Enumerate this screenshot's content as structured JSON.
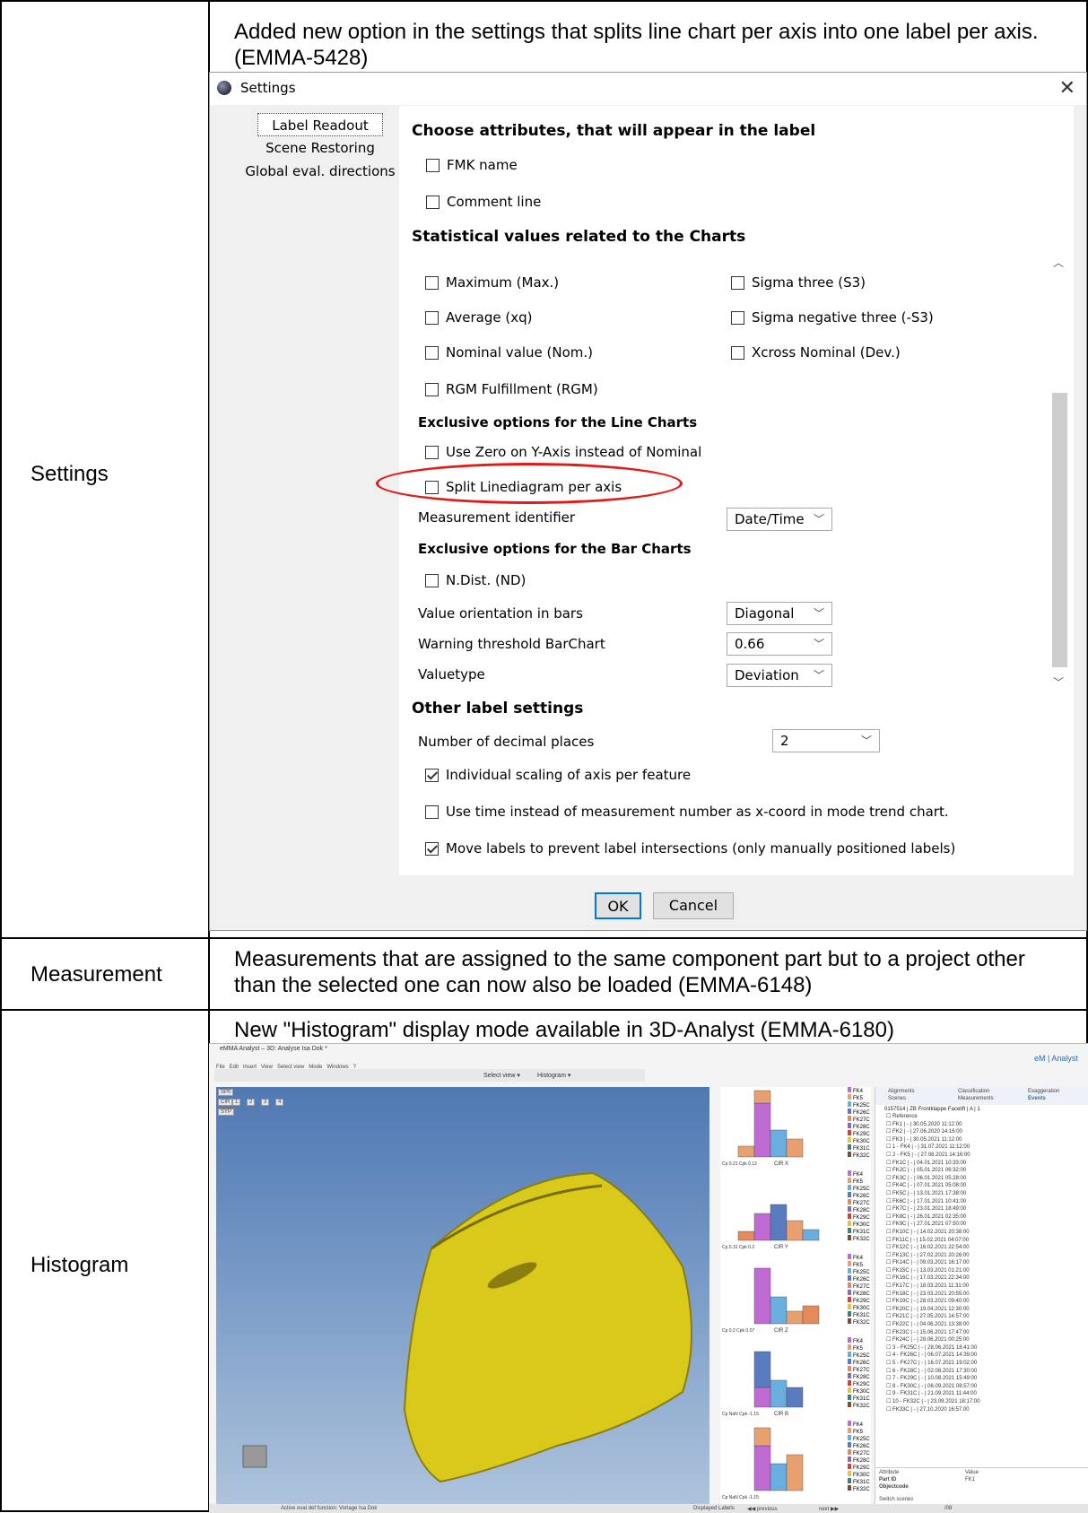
{
  "rows": [
    {
      "label": "Settings",
      "description": "Added new option in the settings that splits line chart per axis into one label per axis. (EMMA-5428)"
    },
    {
      "label": "Measurement",
      "description": "Measurements that are assigned to the same component part but to a project other than the selected one can now also be loaded (EMMA-6148)"
    },
    {
      "label": "Histogram",
      "description": "New \"Histogram\" display mode available in 3D-Analyst (EMMA-6180)"
    }
  ],
  "dialog": {
    "title": "Settings",
    "nav": [
      "Label Readout",
      "Scene Restoring",
      "Global eval. directions"
    ],
    "sections": {
      "attributes": "Choose attributes, that will appear in the label",
      "statistical": "Statistical values related to the Charts",
      "line": "Exclusive options for the Line Charts",
      "bar": "Exclusive options for the Bar Charts",
      "other": "Other label settings"
    },
    "attributes": [
      {
        "label": "FMK name",
        "checked": false
      },
      {
        "label": "Comment line",
        "checked": false
      }
    ],
    "statistical_left": [
      {
        "label": "Maximum (Max.)",
        "checked": false
      },
      {
        "label": "Average (xq)",
        "checked": false
      },
      {
        "label": "Nominal value (Nom.)",
        "checked": false
      },
      {
        "label": "RGM Fulfillment (RGM)",
        "checked": false
      }
    ],
    "statistical_right": [
      {
        "label": "Sigma three (S3)",
        "checked": false
      },
      {
        "label": "Sigma negative three (-S3)",
        "checked": false
      },
      {
        "label": "Xcross Nominal (Dev.)",
        "checked": false
      }
    ],
    "line_options": [
      {
        "label": "Use Zero on Y-Axis instead of Nominal",
        "checked": false
      },
      {
        "label": "Split Linediagram per axis",
        "checked": false
      }
    ],
    "measurement_identifier": {
      "label": "Measurement identifier",
      "value": "Date/Time"
    },
    "bar_options": [
      {
        "label": "N.Dist. (ND)",
        "checked": false
      }
    ],
    "value_orientation": {
      "label": "Value orientation in bars",
      "value": "Diagonal"
    },
    "warning_threshold": {
      "label": "Warning threshold BarChart",
      "value": "0.66"
    },
    "valuetype": {
      "label": "Valuetype",
      "value": "Deviation"
    },
    "decimal_places": {
      "label": "Number of decimal places",
      "value": "2"
    },
    "other_options": [
      {
        "label": "Individual scaling of axis per feature",
        "checked": true
      },
      {
        "label": "Use time instead of measurement number as x-coord in mode trend chart.",
        "checked": false
      },
      {
        "label": "Move labels to prevent label intersections (only manually positioned labels)",
        "checked": true
      }
    ],
    "ok_label": "OK",
    "cancel_label": "Cancel"
  },
  "app": {
    "window_title": "eMMA Analyst – 3D: Analyse Isa Dok *",
    "brand": "eM | Analyst",
    "menu": [
      "File",
      "Edit",
      "Insert",
      "View",
      "Select view",
      "Mode",
      "Windows",
      "?"
    ],
    "toolbar_labels": [
      "Select view ▾",
      "Histogram ▾"
    ],
    "panel_tabs": [
      "Alignments",
      "Classification",
      "Exaggeration",
      "Scenes",
      "Measurements",
      "Events"
    ],
    "tree_root": "0157514 | ZB Frontklappe Facelift | A | 1",
    "tree_items": [
      "Reference",
      "FK1 | - | 30.05.2020 11:12:00",
      "FK2 | - | 27.06.2020 14:16:00",
      "FK3 | - | 30.05.2021 11:12:00",
      "1 - FK4 | - | 31.07.2021 11:12:00",
      "2 - FK5 | - | 27.08.2021 14:16:00",
      "FK1C | - | 04.01.2021 10:33:00",
      "FK2C | - | 05.01.2021 06:32:00",
      "FK3C | - | 06.01.2021 05:28:00",
      "FK4C | - | 07.01.2021 05:08:00",
      "FK5C | - | 13.01.2021 17:38:00",
      "FK6C | - | 17.01.2021 10:41:00",
      "FK7C | - | 23.01.2021 18:49:00",
      "FK8C | - | 26.01.2021 02:35:00",
      "FK9C | - | 27.01.2021 07:50:00",
      "FK10C | - | 14.02.2021 20:38:00",
      "FK11C | - | 15.02.2021 04:07:00",
      "FK12C | - | 16.02.2021 22:54:00",
      "FK13C | - | 27.02.2021 20:26:00",
      "FK14C | - | 09.03.2021 16:17:00",
      "FK15C | - | 13.03.2021 01:21:00",
      "FK16C | - | 17.03.2021 22:34:00",
      "FK17C | - | 18.03.2021 11:31:00",
      "FK18C | - | 23.03.2021 20:55:00",
      "FK19C | - | 28.03.2021 09:40:00",
      "FK20C | - | 19.04.2021 12:30:00",
      "FK21C | - | 27.05.2021 14:57:00",
      "FK22C | - | 04.06.2021 13:38:00",
      "FK23C | - | 15.06.2021 17:47:00",
      "FK24C | - | 28.06.2021 00:25:00",
      "3 - FK25C | - | 28.06.2021 18:41:00",
      "4 - FK26C | - | 06.07.2021 14:39:00",
      "5 - FK27C | - | 16.07.2021 19:02:00",
      "6 - FK28C | - | 02.08.2021 17:30:00",
      "7 - FK29C | - | 10.08.2021 15:49:00",
      "8 - FK30C | - | 06.09.2021 08:57:00",
      "9 - FK31C | - | 21.09.2021 11:44:00",
      "10 - FK32C | - | 23.09.2021 18:17:00",
      "FK33C | - | 27.10.2020 16:57:00"
    ],
    "attr_header": [
      "Attribute",
      "Value"
    ],
    "attr_rows": [
      [
        "Part ID",
        "FK1"
      ],
      [
        "Objectcode",
        ""
      ]
    ],
    "switch_scenes": "Switch scenes",
    "status_text": "Active eval def function: Vorlage Isa Dok",
    "displayed_labels": "Displayed Labels",
    "previous": "◀◀ previous",
    "next": "next ▶▶",
    "page": "/08",
    "legend_items": [
      "FK4",
      "FK5",
      "FK25C",
      "FK26C",
      "FK27C",
      "FK28C",
      "FK29C",
      "FK30C",
      "FK31C",
      "FK32C"
    ],
    "chart_axes": [
      "CIR X",
      "CIR Y",
      "CIR Z",
      "CIR B",
      ""
    ],
    "chart_stats": [
      "Cp 0.21 Cpk 0.12",
      "Cp 0.31 Cpk 0.2",
      "Cp 0.2 Cpk 0.07",
      "Cp NaN Cpk -1.15",
      "Cp NaN Cpk -1.15"
    ],
    "view_buttons": [
      "SP0",
      "CIR",
      "1",
      "2",
      "3",
      "4",
      "SYP"
    ]
  }
}
